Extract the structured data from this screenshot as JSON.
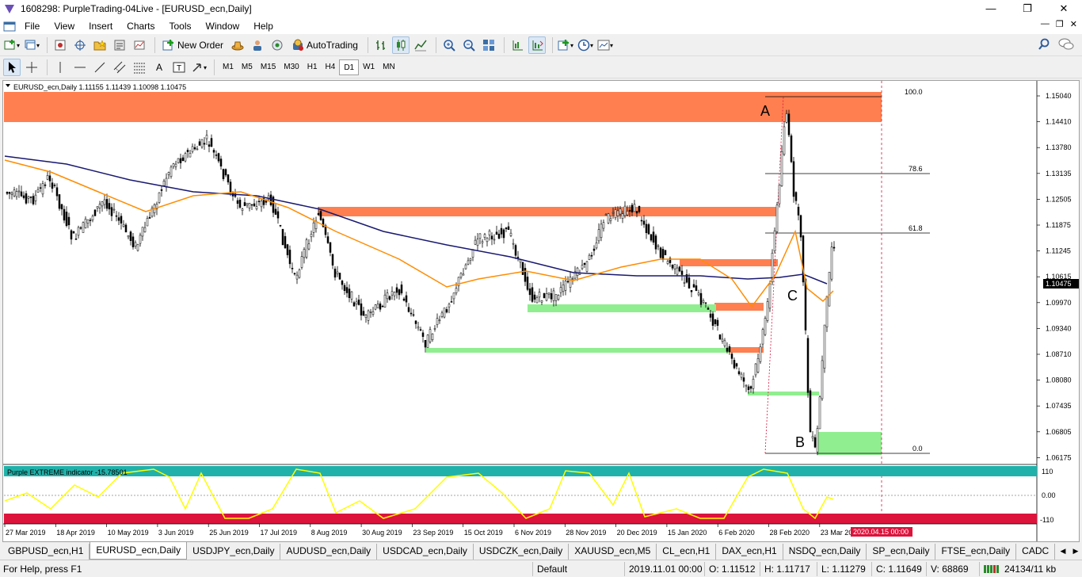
{
  "window": {
    "title": "1608298: PurpleTrading-04Live - [EURUSD_ecn,Daily]"
  },
  "menu": [
    "File",
    "View",
    "Insert",
    "Charts",
    "Tools",
    "Window",
    "Help"
  ],
  "toolbar": {
    "new_order": "New Order",
    "autotrading": "AutoTrading"
  },
  "timeframes": [
    "M1",
    "M5",
    "M15",
    "M30",
    "H1",
    "H4",
    "D1",
    "W1",
    "MN"
  ],
  "active_timeframe": "D1",
  "chart": {
    "header": "EURUSD_ecn,Daily  1.11155 1.11439 1.10098 1.10475",
    "price_labels": [
      "1.15040",
      "1.14410",
      "1.13780",
      "1.13135",
      "1.12505",
      "1.11875",
      "1.11245",
      "1.10615",
      "1.09970",
      "1.09340",
      "1.08710",
      "1.08080",
      "1.07435",
      "1.06805",
      "1.06175"
    ],
    "current_price": "1.10475",
    "fib_labels": [
      "100.0",
      "78.6",
      "61.8",
      "0.0"
    ],
    "wave_labels": [
      "A",
      "B",
      "C"
    ],
    "time_labels": [
      "27 Mar 2019",
      "18 Apr 2019",
      "10 May 2019",
      "3 Jun 2019",
      "25 Jun 2019",
      "17 Jul 2019",
      "8 Aug 2019",
      "30 Aug 2019",
      "23 Sep 2019",
      "15 Oct 2019",
      "6 Nov 2019",
      "28 Nov 2019",
      "20 Dec 2019",
      "15 Jan 2020",
      "6 Feb 2020",
      "28 Feb 2020",
      "23 Mar 2020"
    ],
    "cursor_time": "2020.04.15 00:00",
    "colors": {
      "supply": "#ff7f50",
      "demand": "#90ee90",
      "ma_fast": "#ff8c00",
      "ma_slow": "#191970",
      "indicator": "#ffff00",
      "upper_band": "#20b2aa",
      "lower_band": "#dc143c"
    }
  },
  "indicator": {
    "label": "Purple EXTREME indicator -15.78501",
    "levels": [
      "110",
      "0.00",
      "-110"
    ]
  },
  "tabs": [
    "GBPUSD_ecn,H1",
    "EURUSD_ecn,Daily",
    "USDJPY_ecn,Daily",
    "AUDUSD_ecn,Daily",
    "USDCAD_ecn,Daily",
    "USDCZK_ecn,Daily",
    "XAUUSD_ecn,M5",
    "CL_ecn,H1",
    "DAX_ecn,H1",
    "NSDQ_ecn,Daily",
    "SP_ecn,Daily",
    "FTSE_ecn,Daily",
    "CADC"
  ],
  "active_tab": "EURUSD_ecn,Daily",
  "status": {
    "help": "For Help, press F1",
    "profile": "Default",
    "datetime": "2019.11.01 00:00",
    "open": "O: 1.11512",
    "high": "H: 1.11717",
    "low": "L: 1.11279",
    "close": "C: 1.11649",
    "volume": "V: 68869",
    "traffic": "24134/11 kb"
  }
}
